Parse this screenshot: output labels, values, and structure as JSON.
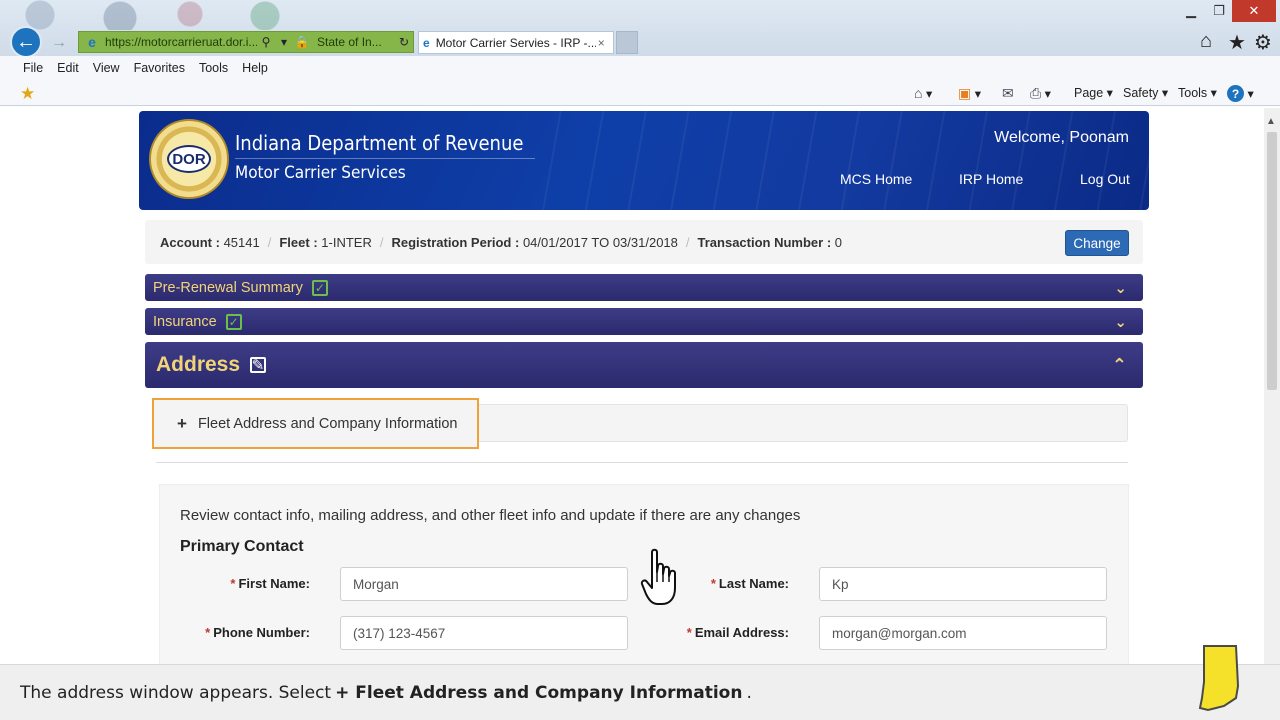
{
  "browser": {
    "url": "https://motorcarrieruat.dor.i...",
    "cert": "State of In...",
    "tab_label": "Motor Carrier Servies - IRP -...",
    "tab_close": "×",
    "menu": [
      "File",
      "Edit",
      "View",
      "Favorites",
      "Tools",
      "Help"
    ],
    "cmd": {
      "page": "Page ▾",
      "safety": "Safety ▾",
      "tools": "Tools ▾"
    }
  },
  "header": {
    "title": "Indiana Department of Revenue",
    "subtitle": "Motor Carrier Services",
    "seal_text": "DOR",
    "welcome": "Welcome, Poonam",
    "nav": {
      "mcs_home": "MCS Home",
      "irp_home": "IRP Home",
      "logout": "Log Out"
    }
  },
  "account": {
    "account_label": "Account :",
    "account_value": "45141",
    "fleet_label": "Fleet :",
    "fleet_value": "1-INTER",
    "period_label": "Registration Period :",
    "period_value": "04/01/2017 TO 03/31/2018",
    "txn_label": "Transaction Number :",
    "txn_value": "0",
    "change_button": "Change"
  },
  "panels": {
    "pre_renewal": "Pre-Renewal Summary",
    "insurance": "Insurance",
    "address": "Address"
  },
  "fleet_section": {
    "plus": "+",
    "label": "Fleet Address and Company Information"
  },
  "form": {
    "intro": "Review contact info, mailing address, and other fleet info and update if there are any changes",
    "section_title": "Primary Contact",
    "required_mark": "*",
    "first_name_label": "First Name:",
    "first_name_value": "Morgan",
    "last_name_label": "Last Name:",
    "last_name_value": "Kp",
    "phone_label": "Phone Number:",
    "phone_value": "(317) 123-4567",
    "email_label": "Email Address:",
    "email_value": "morgan@morgan.com"
  },
  "caption": {
    "prefix": "The address window appears. Select",
    "bold": "+ Fleet Address and Company Information",
    "suffix": "."
  },
  "colors": {
    "header_blue": "#0e3fa8",
    "panel_purple": "#3d3c86",
    "panel_text_gold": "#f2d477",
    "highlight_orange": "#f0a23a",
    "button_blue": "#2d6ab5",
    "check_green": "#6cc04a"
  }
}
